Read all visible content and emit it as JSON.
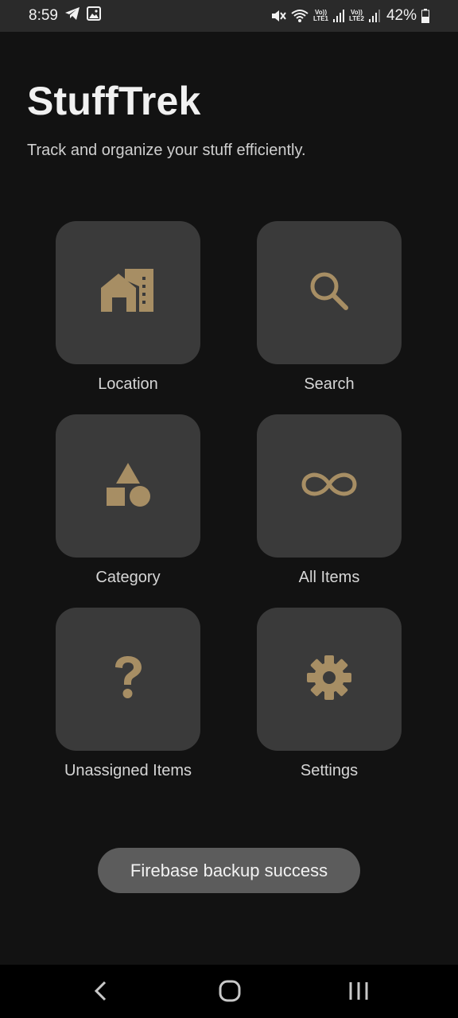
{
  "status_bar": {
    "time": "8:59",
    "sim1": "LTE1",
    "sim2": "LTE2",
    "volte": "Vo))",
    "battery": "42%"
  },
  "app": {
    "title": "StuffTrek",
    "subtitle": "Track and organize your stuff efficiently."
  },
  "tiles": [
    {
      "label": "Location",
      "icon": "building-icon"
    },
    {
      "label": "Search",
      "icon": "search-icon"
    },
    {
      "label": "Category",
      "icon": "shapes-icon"
    },
    {
      "label": "All Items",
      "icon": "infinity-icon"
    },
    {
      "label": "Unassigned Items",
      "icon": "question-icon"
    },
    {
      "label": "Settings",
      "icon": "gear-icon"
    }
  ],
  "toast": {
    "text": "Firebase backup success"
  },
  "colors": {
    "accent": "#a78e64",
    "background": "#121212",
    "tile": "#3a3a3a",
    "toast": "#5c5c5c"
  }
}
